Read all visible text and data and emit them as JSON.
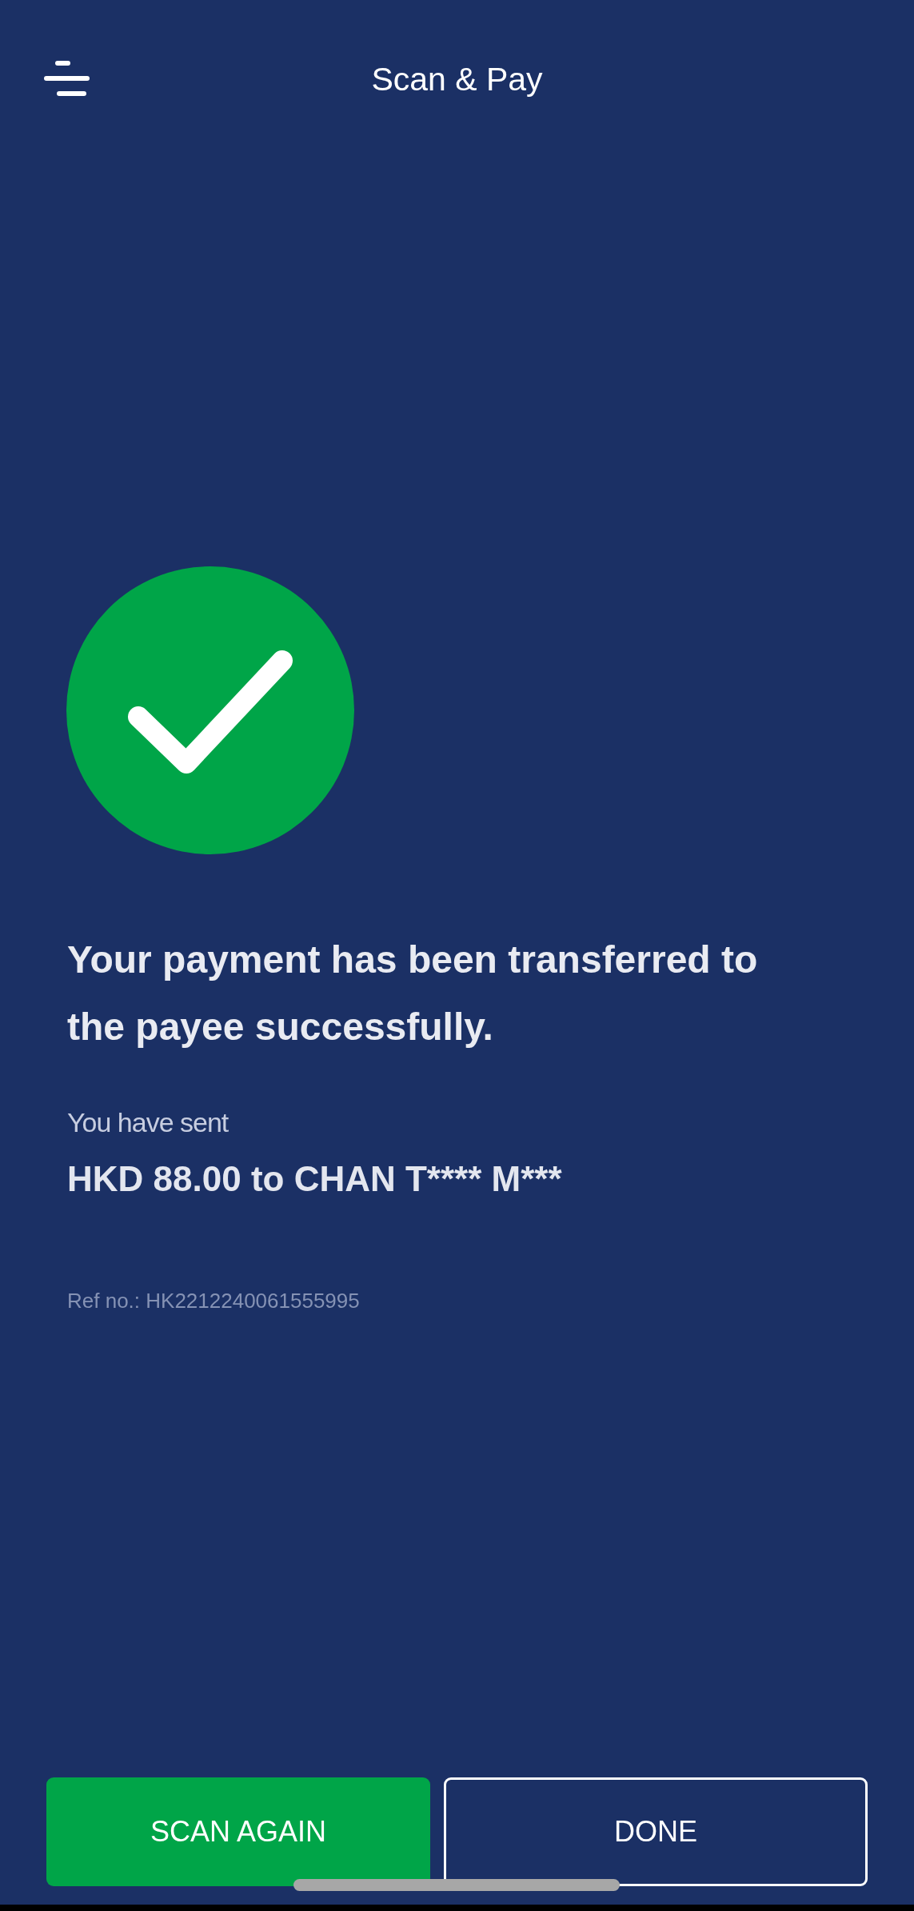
{
  "header": {
    "title": "Scan & Pay"
  },
  "message": "Your payment has been transferred to the payee successfully.",
  "sent_label": "You have sent",
  "sent_amount": "HKD 88.00 to CHAN T**** M***",
  "reference": "Ref no.: HK2212240061555995",
  "buttons": [
    {
      "label": "SCAN AGAIN",
      "kind": "primary"
    },
    {
      "label": "DONE",
      "kind": "outline"
    }
  ]
}
